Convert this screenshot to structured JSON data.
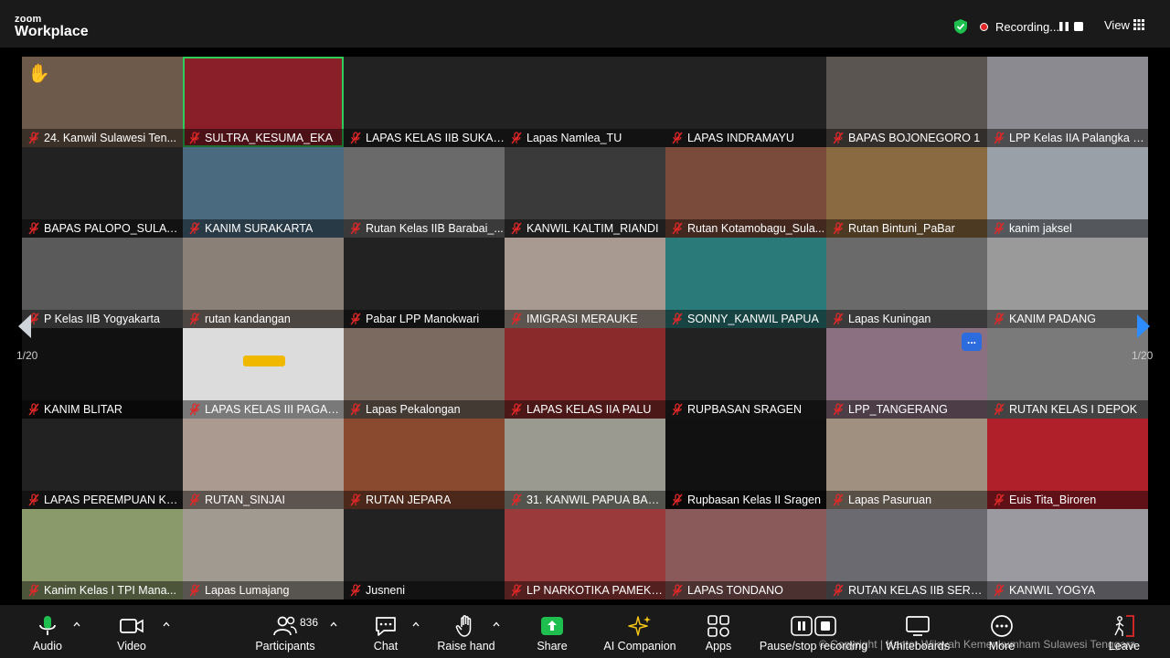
{
  "app": {
    "brand_top": "zoom",
    "brand_bottom": "Workplace"
  },
  "header": {
    "recording_label": "Recording...",
    "view_label": "View"
  },
  "colors": {
    "speaker_border": "#2ecc5b",
    "mic_muted": "#e02828",
    "share_green": "#1fbf4f",
    "accent_blue": "#2d8cff"
  },
  "navigation": {
    "prev_page": "1/20",
    "next_page": "1/20"
  },
  "participants_tiles": [
    {
      "name": "24. Kanwil Sulawesi Ten...",
      "bg": "#6e5a4a",
      "hand": true
    },
    {
      "name": "SULTRA_KESUMA_EKA",
      "bg": "#8a1f2a",
      "speaker": true
    },
    {
      "name": "LAPAS KELAS IIB SUKAB...",
      "bg": "#222222"
    },
    {
      "name": "Lapas Namlea_TU",
      "bg": "#222222"
    },
    {
      "name": "LAPAS INDRAMAYU",
      "bg": "#222222"
    },
    {
      "name": "BAPAS BOJONEGORO 1",
      "bg": "#5a5550"
    },
    {
      "name": "LPP Kelas IIA Palangka R...",
      "bg": "#8a8a90"
    },
    {
      "name": "BAPAS PALOPO_SULAWE...",
      "bg": "#222222"
    },
    {
      "name": "KANIM SURAKARTA",
      "bg": "#4a6a80"
    },
    {
      "name": "Rutan Kelas IIB Barabai_...",
      "bg": "#6a6a6a"
    },
    {
      "name": "KANWIL KALTIM_RIANDI",
      "bg": "#3a3a3a"
    },
    {
      "name": "Rutan Kotamobagu_Sula...",
      "bg": "#7a4a3a"
    },
    {
      "name": "Rutan Bintuni_PaBar",
      "bg": "#8a6a40"
    },
    {
      "name": "kanim jaksel",
      "bg": "#9aa0a8"
    },
    {
      "name": "P Kelas IIB Yogyakarta",
      "bg": "#5a5a5a"
    },
    {
      "name": "rutan kandangan",
      "bg": "#8a8078"
    },
    {
      "name": "Pabar LPP Manokwari",
      "bg": "#222222"
    },
    {
      "name": "IMIGRASI MERAUKE",
      "bg": "#a89a90"
    },
    {
      "name": "SONNY_KANWIL PAPUA",
      "bg": "#2a7a7a"
    },
    {
      "name": "Lapas Kuningan",
      "bg": "#6a6a6a"
    },
    {
      "name": "KANIM PADANG",
      "bg": "#9a9a9a"
    },
    {
      "name": "KANIM BLITAR",
      "bg": "#111111"
    },
    {
      "name": "LAPAS KELAS III PAGAR ...",
      "bg": "#dcdcdc",
      "banner": true
    },
    {
      "name": "Lapas Pekalongan",
      "bg": "#7a6a60"
    },
    {
      "name": "LAPAS KELAS IIA PALU",
      "bg": "#8a2a2a"
    },
    {
      "name": "RUPBASAN SRAGEN",
      "bg": "#222222"
    },
    {
      "name": "LPP_TANGERANG",
      "bg": "#8a7080",
      "more": "..."
    },
    {
      "name": "RUTAN KELAS I DEPOK",
      "bg": "#7a7a7a"
    },
    {
      "name": "LAPAS PEREMPUAN KEL...",
      "bg": "#222222"
    },
    {
      "name": "RUTAN_SINJAI",
      "bg": "#aa9a90"
    },
    {
      "name": "RUTAN JEPARA",
      "bg": "#8a4a30"
    },
    {
      "name": "31. KANWIL PAPUA BARAT",
      "bg": "#9a9a90"
    },
    {
      "name": "Rupbasan Kelas II Sragen",
      "bg": "#111111"
    },
    {
      "name": "Lapas Pasuruan",
      "bg": "#a09080"
    },
    {
      "name": "Euis Tita_Biroren",
      "bg": "#b0202a"
    },
    {
      "name": "Kanim Kelas I TPI Mana...",
      "bg": "#8a9a6a"
    },
    {
      "name": "Lapas Lumajang",
      "bg": "#a09a90"
    },
    {
      "name": "Jusneni",
      "bg": "#222222"
    },
    {
      "name": "LP NARKOTIKA PAMEKA...",
      "bg": "#9a3a3a"
    },
    {
      "name": "LAPAS TONDANO",
      "bg": "#8a5a5a"
    },
    {
      "name": "RUTAN KELAS IIB SERANG",
      "bg": "#6a6a70"
    },
    {
      "name": "KANWIL YOGYA",
      "bg": "#9a9aa0"
    }
  ],
  "toolbar": {
    "audio": "Audio",
    "video": "Video",
    "participants": "Participants",
    "participants_count": "836",
    "chat": "Chat",
    "raise_hand": "Raise hand",
    "share": "Share",
    "ai_companion": "AI Companion",
    "apps": "Apps",
    "pause_stop_recording": "Pause/stop recording",
    "whiteboards": "Whiteboards",
    "more": "More",
    "leave": "Leave"
  },
  "watermark": "© Copyright | Kantor Wilayah Kemenkumham Sulawesi Tenggara"
}
